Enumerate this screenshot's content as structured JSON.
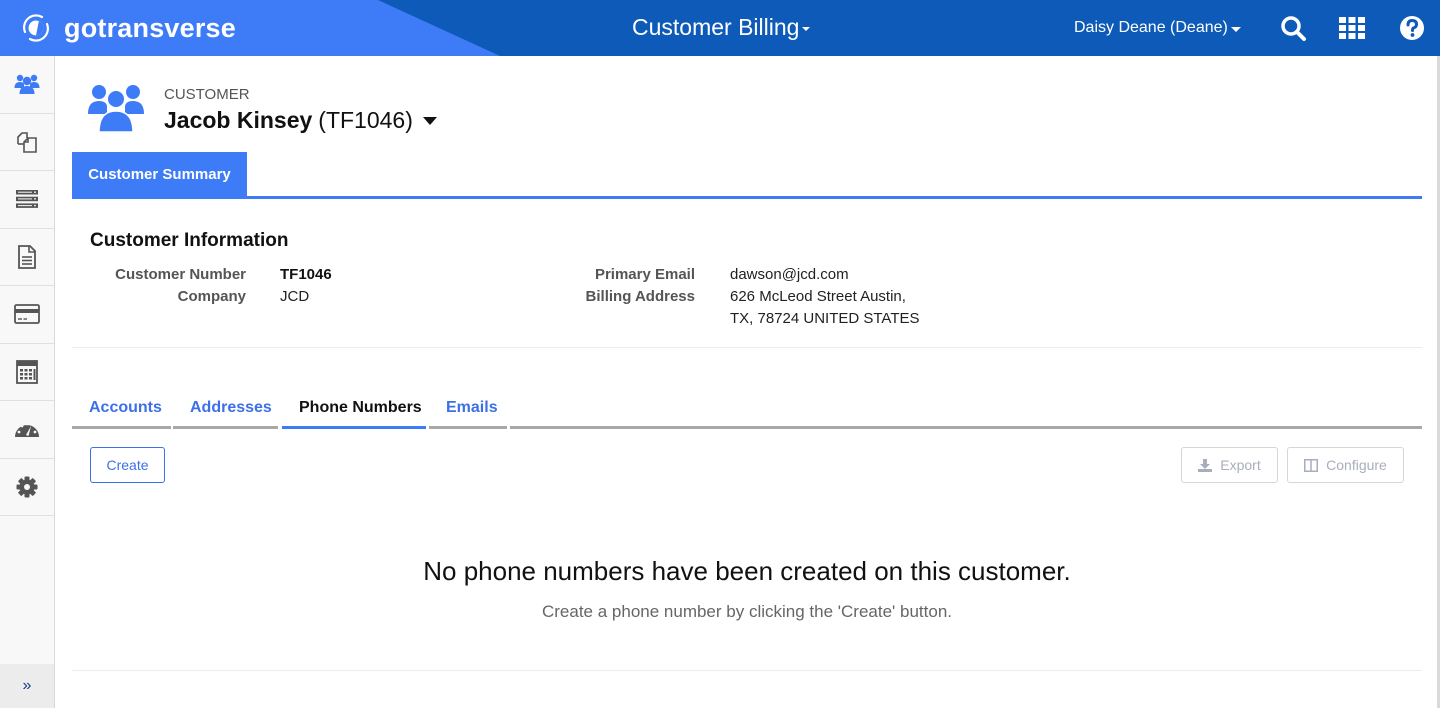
{
  "header": {
    "brand_name": "gotransverse",
    "app_title": "Customer Billing",
    "user_name": "Daisy Deane (Deane)",
    "icons": [
      "search-icon",
      "apps-grid-icon",
      "help-icon"
    ],
    "brand_color": "#3d7bf7",
    "bar_color": "#0d5ab8"
  },
  "sidebar": {
    "items": [
      {
        "icon": "customers-icon",
        "active": true
      },
      {
        "icon": "documents-icon"
      },
      {
        "icon": "server-list-icon"
      },
      {
        "icon": "file-text-icon"
      },
      {
        "icon": "credit-card-icon"
      },
      {
        "icon": "calculator-icon"
      },
      {
        "icon": "dashboard-gauge-icon"
      },
      {
        "icon": "settings-gear-icon"
      }
    ],
    "expand_label": "»"
  },
  "customer": {
    "label": "CUSTOMER",
    "name": "Jacob Kinsey",
    "id": "(TF1046)"
  },
  "summary_tab": {
    "label": "Customer Summary"
  },
  "info": {
    "title": "Customer Information",
    "left": [
      {
        "label": "Customer Number",
        "value": "TF1046"
      },
      {
        "label": "Company",
        "value": "JCD"
      }
    ],
    "right": [
      {
        "label": "Primary Email",
        "value": "dawson@jcd.com"
      },
      {
        "label": "Billing Address",
        "value": "626 McLeod Street Austin,",
        "value2": "TX, 78724 UNITED STATES"
      }
    ]
  },
  "tabs": [
    {
      "label": "Accounts",
      "active": false
    },
    {
      "label": "Addresses",
      "active": false
    },
    {
      "label": "Phone Numbers",
      "active": true
    },
    {
      "label": "Emails",
      "active": false
    }
  ],
  "toolbar": {
    "create_label": "Create",
    "export_label": "Export",
    "configure_label": "Configure"
  },
  "empty_state": {
    "title": "No phone numbers have been created on this customer.",
    "subtitle": "Create a phone number by clicking the 'Create' button."
  }
}
